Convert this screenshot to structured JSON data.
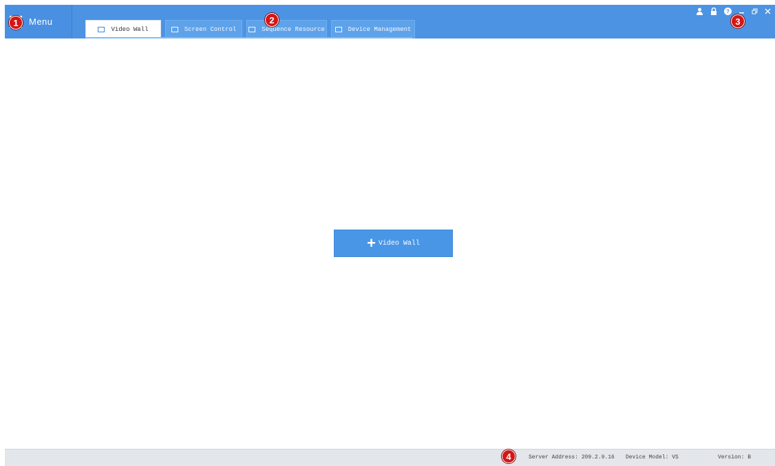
{
  "header": {
    "menu_label": "Menu",
    "tabs": [
      {
        "label": "Video Wall",
        "icon": "grid-icon",
        "active": true
      },
      {
        "label": "Screen Control",
        "icon": "monitor-icon",
        "active": false
      },
      {
        "label": "Sequence Resource",
        "icon": "sequence-icon",
        "active": false
      },
      {
        "label": "Device Management",
        "icon": "device-icon",
        "active": false
      }
    ],
    "controls": {
      "user": "user-icon",
      "lock": "lock-icon",
      "help": "help-icon",
      "minimize": "minimize-icon",
      "restore": "restore-icon",
      "close": "close-icon"
    }
  },
  "main": {
    "add_button_label": "Video Wall"
  },
  "statusbar": {
    "server_address": "Server Address: 209.2.9.16",
    "device_model": "Device Model: VS",
    "version": "Version: B"
  },
  "callouts": [
    "1",
    "2",
    "3",
    "4"
  ],
  "colors": {
    "accent": "#4c93e3",
    "button": "#4a96e6",
    "callout": "#d41616"
  }
}
